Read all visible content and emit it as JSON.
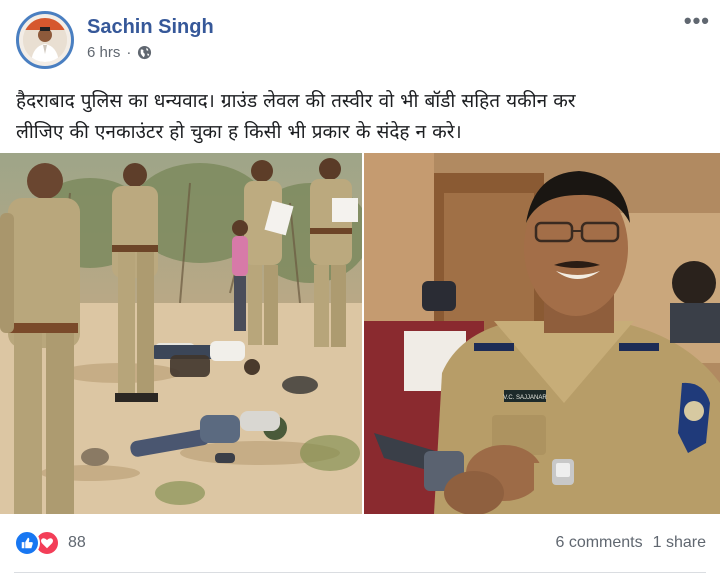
{
  "post": {
    "author": "Sachin Singh",
    "timestamp": "6 hrs",
    "privacy_icon": "globe-icon",
    "more_icon": "more-options-icon",
    "text_lines": [
      "हैदराबाद पुलिस का धन्यवाद। ग्राउंड लेवल की तस्वीर वो भी बॉडी सहित यकीन कर",
      "लीजिए की एनकाउंटर हो चुका ह किसी भी प्रकार के संदेह न करे।"
    ],
    "photos": [
      {
        "icon": "police-scene-photo"
      },
      {
        "icon": "officer-portrait-photo"
      }
    ],
    "officer_nameplate": "V.C. SAJJANAR"
  },
  "footer": {
    "reaction_count": "88",
    "comments": "6 comments",
    "shares": "1 share"
  },
  "colors": {
    "author_link": "#365899",
    "like_blue": "#1877f2",
    "love_red": "#f33e58",
    "meta_grey": "#606770"
  }
}
